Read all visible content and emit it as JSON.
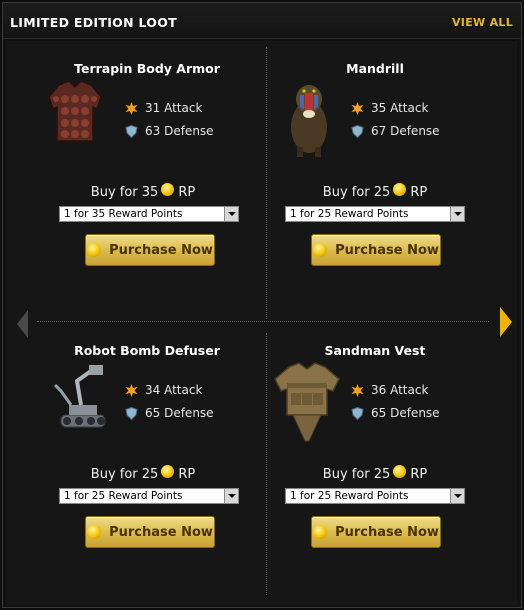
{
  "header": {
    "title": "LIMITED EDITION LOOT",
    "view_all": "VIEW ALL"
  },
  "items": [
    {
      "name": "Terrapin Body Armor",
      "attack": "31 Attack",
      "defense": "63 Defense",
      "buy_prefix": "Buy for 35",
      "currency": "RP",
      "option": "1 for 35 Reward Points",
      "button": "Purchase Now",
      "image": "armor-vest-image"
    },
    {
      "name": "Mandrill",
      "attack": "35 Attack",
      "defense": "67 Defense",
      "buy_prefix": "Buy for 25",
      "currency": "RP",
      "option": "1 for 25 Reward Points",
      "button": "Purchase Now",
      "image": "mandrill-image"
    },
    {
      "name": "Robot Bomb Defuser",
      "attack": "34 Attack",
      "defense": "65 Defense",
      "buy_prefix": "Buy for 25",
      "currency": "RP",
      "option": "1 for 25 Reward Points",
      "button": "Purchase Now",
      "image": "robot-image"
    },
    {
      "name": "Sandman Vest",
      "attack": "36 Attack",
      "defense": "65 Defense",
      "buy_prefix": "Buy for 25",
      "currency": "RP",
      "option": "1 for 25 Reward Points",
      "button": "Purchase Now",
      "image": "tactical-vest-image"
    }
  ],
  "colors": {
    "accent": "#e8b820",
    "arrow_active": "#f0b400",
    "arrow_inactive": "#4a4a4a"
  }
}
